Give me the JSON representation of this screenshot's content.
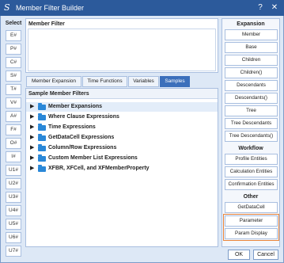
{
  "window": {
    "title": "Member Filter Builder",
    "app_icon": "onestream-script-icon",
    "help_glyph": "?",
    "close_glyph": "✕"
  },
  "select": {
    "title": "Select",
    "buttons": [
      "E#",
      "P#",
      "C#",
      "S#",
      "T#",
      "V#",
      "A#",
      "F#",
      "O#",
      "I#",
      "U1#",
      "U2#",
      "U3#",
      "U4#",
      "U5#",
      "U6#",
      "U7#"
    ]
  },
  "member_filter": {
    "label": "Member Filter",
    "value": ""
  },
  "tabs": [
    {
      "label": "Member Expansion",
      "active": false
    },
    {
      "label": "Time Functions",
      "active": false
    },
    {
      "label": "Variables",
      "active": false
    },
    {
      "label": "Samples",
      "active": true
    }
  ],
  "samples": {
    "header": "Sample Member Filters",
    "items": [
      "Member Expansions",
      "Where Clause Expressions",
      "Time Expressions",
      "GetDataCell Expressions",
      "Column/Row Expressions",
      "Custom Member List Expressions",
      "XFBR, XFCell, and XFMemberProperty"
    ]
  },
  "expansion": {
    "title": "Expansion",
    "buttons": [
      "Member",
      "Base",
      "Children",
      "Children()",
      "Descendants",
      "Descendants()",
      "Tree",
      "Tree Descendants",
      "Tree Descendants()"
    ]
  },
  "workflow": {
    "title": "Workflow",
    "buttons": [
      "Profile Entities",
      "Calculation Entities",
      "Confirmation Entities"
    ]
  },
  "other": {
    "title": "Other",
    "buttons": [
      "GetDataCell",
      "Parameter",
      "Param Display"
    ],
    "highlighted": [
      "Parameter",
      "Param Display"
    ],
    "highlight_color": "#e8843a"
  },
  "footer": {
    "ok": "OK",
    "cancel": "Cancel"
  },
  "colors": {
    "titlebar": "#2c5a9b",
    "active_tab": "#3b6fbb",
    "folder": "#2a88d8"
  }
}
